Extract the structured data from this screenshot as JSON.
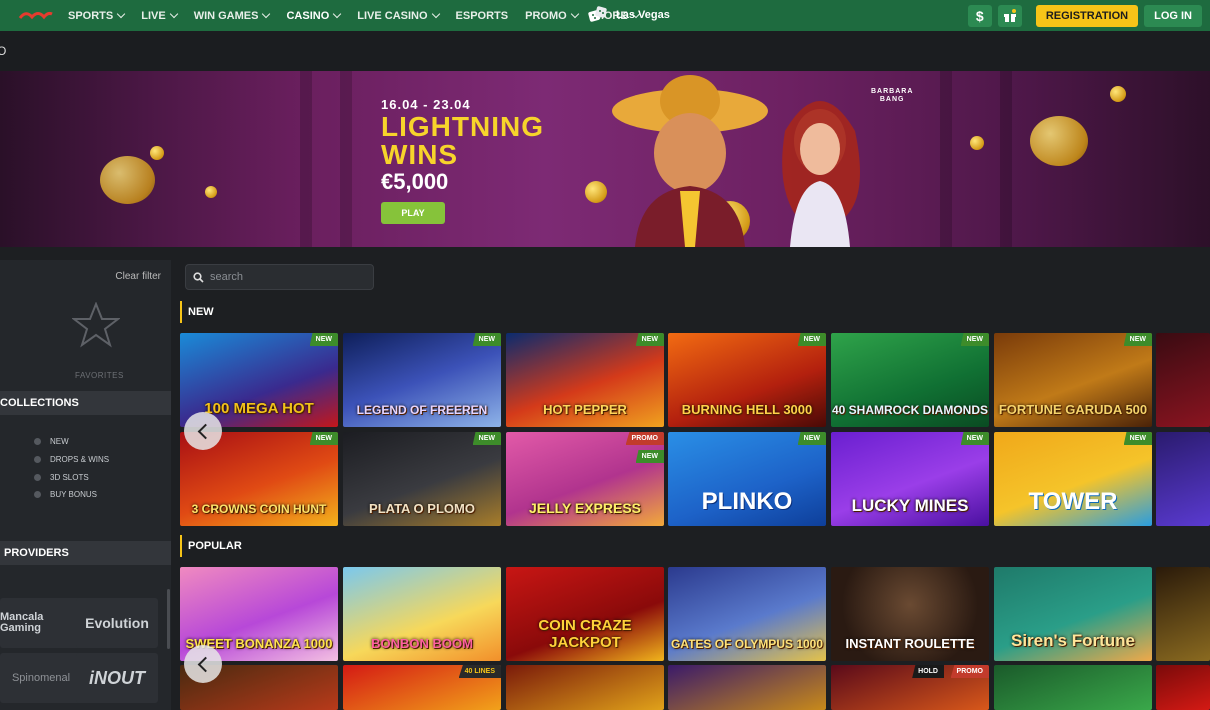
{
  "nav": {
    "items": [
      {
        "label": "SPORTS"
      },
      {
        "label": "LIVE"
      },
      {
        "label": "WIN GAMES"
      },
      {
        "label": "CASINO"
      },
      {
        "label": "LIVE CASINO"
      },
      {
        "label": "ESPORTS"
      },
      {
        "label": "PROMO"
      },
      {
        "label": "MORE"
      }
    ],
    "active": "CASINO",
    "las_vegas": "Las Vegas",
    "dollar": "$",
    "registration": "REGISTRATION",
    "login": "LOG IN"
  },
  "breadcrumb": {
    "text": "O"
  },
  "banner": {
    "date": "16.04 - 23.04",
    "title_line1": "LIGHTNING",
    "title_line2": "WINS",
    "amount": "€5,000",
    "play": "PLAY",
    "brand_line1": "BARBARA",
    "brand_line2": "BANG"
  },
  "sidebar": {
    "clear_filter": "Clear filter",
    "favorites": "FAVORITES",
    "collections_title": "COLLECTIONS",
    "collections": [
      "NEW",
      "DROPS & WINS",
      "3D SLOTS",
      "BUY BONUS"
    ],
    "providers_title": "PROVIDERS",
    "providers": [
      "Mancala Gaming",
      "Evolution",
      "Spinomenal",
      "iNOUT"
    ]
  },
  "search": {
    "placeholder": "search"
  },
  "sections": {
    "new": "NEW",
    "popular": "POPULAR"
  },
  "new_games": [
    {
      "title": "100 MEGA HOT",
      "badge": "NEW"
    },
    {
      "title": "LEGEND OF FREEREN",
      "badge": "NEW"
    },
    {
      "title": "HOT PEPPER",
      "badge": "NEW"
    },
    {
      "title": "BURNING HELL 3000",
      "badge": "NEW"
    },
    {
      "title": "40 SHAMROCK DIAMONDS",
      "badge": "NEW"
    },
    {
      "title": "FORTUNE GARUDA 500",
      "badge": "NEW"
    },
    {
      "title": "3 CROWNS COIN HUNT",
      "badge": "NEW"
    },
    {
      "title": "PLATA O PLOMO",
      "badge": "NEW"
    },
    {
      "title": "JELLY EXPRESS",
      "badge": "PROMO",
      "badge2": "NEW"
    },
    {
      "title": "PLINKO",
      "badge": "NEW"
    },
    {
      "title": "LUCKY MINES",
      "badge": "NEW"
    },
    {
      "title": "TOWER",
      "badge": "NEW"
    }
  ],
  "popular_games": [
    {
      "title": "SWEET BONANZA 1000"
    },
    {
      "title": "BONBON BOOM"
    },
    {
      "title": "COIN CRAZE JACKPOT"
    },
    {
      "title": "GATES OF OLYMPUS 1000"
    },
    {
      "title": "INSTANT ROULETTE"
    },
    {
      "title": "Siren's Fortune"
    }
  ],
  "popular_row2_badges": {
    "forty_lines": "40 LINES",
    "hold": "HOLD",
    "promo": "PROMO"
  }
}
